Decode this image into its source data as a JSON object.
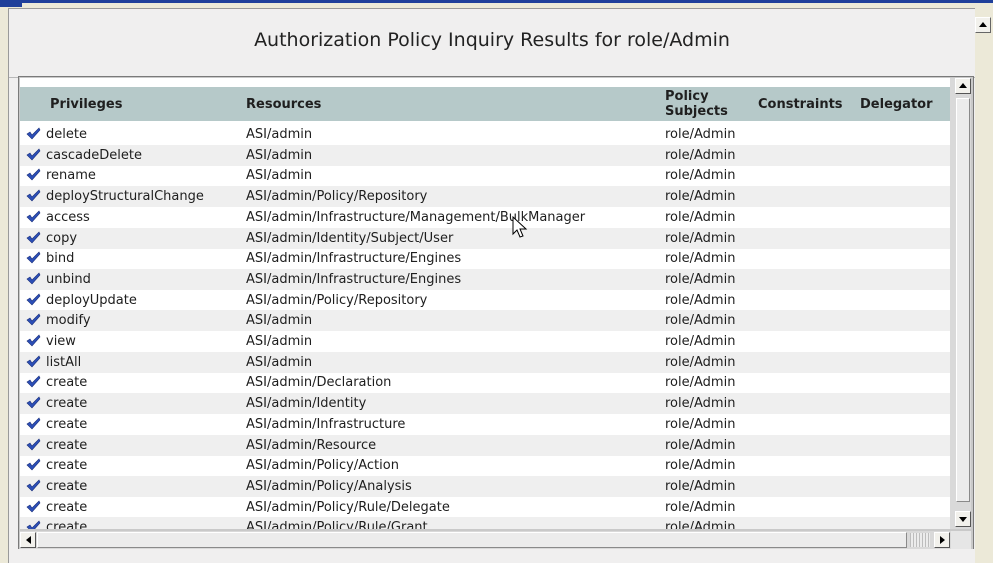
{
  "title": "Authorization Policy Inquiry Results for role/Admin",
  "columns": {
    "privileges": "Privileges",
    "resources": "Resources",
    "policy_subjects_line1": "Policy",
    "policy_subjects_line2": "Subjects",
    "constraints": "Constraints",
    "delegator": "Delegator"
  },
  "rows": [
    {
      "privilege": "delete",
      "resource": "ASI/admin",
      "subject": "role/Admin"
    },
    {
      "privilege": "cascadeDelete",
      "resource": "ASI/admin",
      "subject": "role/Admin"
    },
    {
      "privilege": "rename",
      "resource": "ASI/admin",
      "subject": "role/Admin"
    },
    {
      "privilege": "deployStructuralChange",
      "resource": "ASI/admin/Policy/Repository",
      "subject": "role/Admin"
    },
    {
      "privilege": "access",
      "resource": "ASI/admin/Infrastructure/Management/BulkManager",
      "subject": "role/Admin"
    },
    {
      "privilege": "copy",
      "resource": "ASI/admin/Identity/Subject/User",
      "subject": "role/Admin"
    },
    {
      "privilege": "bind",
      "resource": "ASI/admin/Infrastructure/Engines",
      "subject": "role/Admin"
    },
    {
      "privilege": "unbind",
      "resource": "ASI/admin/Infrastructure/Engines",
      "subject": "role/Admin"
    },
    {
      "privilege": "deployUpdate",
      "resource": "ASI/admin/Policy/Repository",
      "subject": "role/Admin"
    },
    {
      "privilege": "modify",
      "resource": "ASI/admin",
      "subject": "role/Admin"
    },
    {
      "privilege": "view",
      "resource": "ASI/admin",
      "subject": "role/Admin"
    },
    {
      "privilege": "listAll",
      "resource": "ASI/admin",
      "subject": "role/Admin"
    },
    {
      "privilege": "create",
      "resource": "ASI/admin/Declaration",
      "subject": "role/Admin"
    },
    {
      "privilege": "create",
      "resource": "ASI/admin/Identity",
      "subject": "role/Admin"
    },
    {
      "privilege": "create",
      "resource": "ASI/admin/Infrastructure",
      "subject": "role/Admin"
    },
    {
      "privilege": "create",
      "resource": "ASI/admin/Resource",
      "subject": "role/Admin"
    },
    {
      "privilege": "create",
      "resource": "ASI/admin/Policy/Action",
      "subject": "role/Admin"
    },
    {
      "privilege": "create",
      "resource": "ASI/admin/Policy/Analysis",
      "subject": "role/Admin"
    },
    {
      "privilege": "create",
      "resource": "ASI/admin/Policy/Rule/Delegate",
      "subject": "role/Admin"
    },
    {
      "privilege": "create",
      "resource": "ASI/admin/Policy/Rule/Grant",
      "subject": "role/Admin"
    }
  ],
  "icons": {
    "grant": "checkmark-icon",
    "cursor": "mouse-cursor-icon",
    "scroll_up": "arrow-up-icon",
    "scroll_down": "arrow-down-icon",
    "scroll_left": "arrow-left-icon",
    "scroll_right": "arrow-right-icon"
  },
  "colors": {
    "header_bg": "#b6c9c9",
    "check": "#2c4fb8",
    "title_bar": "#1f3f9a"
  }
}
